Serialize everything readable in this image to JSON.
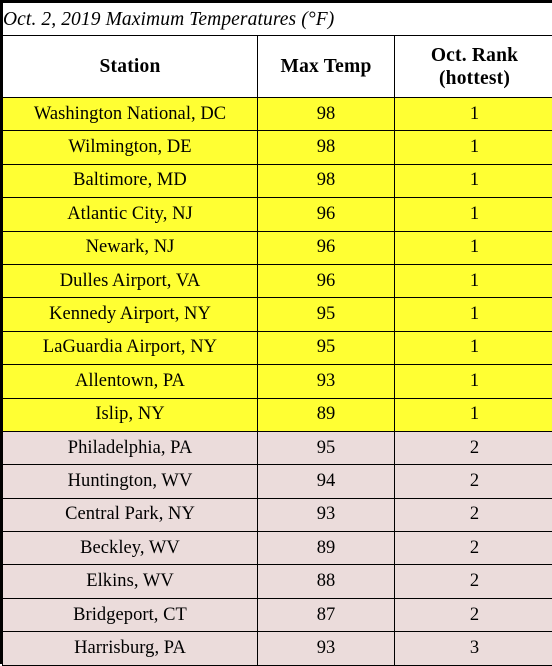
{
  "table": {
    "title": "Oct. 2, 2019 Maximum Temperatures (°F)",
    "columns": [
      {
        "key": "station",
        "label": "Station"
      },
      {
        "key": "max_temp",
        "label": "Max Temp"
      },
      {
        "key": "rank_line1",
        "label": "Oct. Rank"
      },
      {
        "key": "rank_line2",
        "label": "(hottest)"
      }
    ],
    "header": {
      "station": "Station",
      "max_temp": "Max Temp",
      "rank_line1": "Oct. Rank",
      "rank_line2": "(hottest)"
    },
    "colors": {
      "band_rank1": "#FFFF33",
      "band_rank2": "#EBDCDB",
      "border": "#000000",
      "text": "#000000",
      "background": "#FFFFFF"
    },
    "rows": [
      {
        "station": "Washington National, DC",
        "max_temp": "98",
        "rank": "1",
        "band": "yellow"
      },
      {
        "station": "Wilmington, DE",
        "max_temp": "98",
        "rank": "1",
        "band": "yellow"
      },
      {
        "station": "Baltimore, MD",
        "max_temp": "98",
        "rank": "1",
        "band": "yellow"
      },
      {
        "station": "Atlantic City, NJ",
        "max_temp": "96",
        "rank": "1",
        "band": "yellow"
      },
      {
        "station": "Newark, NJ",
        "max_temp": "96",
        "rank": "1",
        "band": "yellow"
      },
      {
        "station": "Dulles Airport, VA",
        "max_temp": "96",
        "rank": "1",
        "band": "yellow"
      },
      {
        "station": "Kennedy Airport, NY",
        "max_temp": "95",
        "rank": "1",
        "band": "yellow"
      },
      {
        "station": "LaGuardia Airport, NY",
        "max_temp": "95",
        "rank": "1",
        "band": "yellow"
      },
      {
        "station": "Allentown, PA",
        "max_temp": "93",
        "rank": "1",
        "band": "yellow"
      },
      {
        "station": "Islip, NY",
        "max_temp": "89",
        "rank": "1",
        "band": "yellow"
      },
      {
        "station": "Philadelphia, PA",
        "max_temp": "95",
        "rank": "2",
        "band": "pink"
      },
      {
        "station": "Huntington, WV",
        "max_temp": "94",
        "rank": "2",
        "band": "pink"
      },
      {
        "station": "Central Park, NY",
        "max_temp": "93",
        "rank": "2",
        "band": "pink"
      },
      {
        "station": "Beckley, WV",
        "max_temp": "89",
        "rank": "2",
        "band": "pink"
      },
      {
        "station": "Elkins, WV",
        "max_temp": "88",
        "rank": "2",
        "band": "pink"
      },
      {
        "station": "Bridgeport, CT",
        "max_temp": "87",
        "rank": "2",
        "band": "pink"
      },
      {
        "station": "Harrisburg, PA",
        "max_temp": "93",
        "rank": "3",
        "band": "pink"
      }
    ]
  },
  "chart_data": {
    "type": "table",
    "title": "Oct. 2, 2019 Maximum Temperatures (°F)",
    "columns": [
      "Station",
      "Max Temp",
      "Oct. Rank (hottest)"
    ],
    "rows": [
      [
        "Washington National, DC",
        98,
        1
      ],
      [
        "Wilmington, DE",
        98,
        1
      ],
      [
        "Baltimore, MD",
        98,
        1
      ],
      [
        "Atlantic City, NJ",
        96,
        1
      ],
      [
        "Newark, NJ",
        96,
        1
      ],
      [
        "Dulles Airport, VA",
        96,
        1
      ],
      [
        "Kennedy Airport, NY",
        95,
        1
      ],
      [
        "LaGuardia Airport, NY",
        95,
        1
      ],
      [
        "Allentown, PA",
        93,
        1
      ],
      [
        "Islip, NY",
        89,
        1
      ],
      [
        "Philadelphia, PA",
        95,
        2
      ],
      [
        "Huntington, WV",
        94,
        2
      ],
      [
        "Central Park, NY",
        93,
        2
      ],
      [
        "Beckley, WV",
        89,
        2
      ],
      [
        "Elkins, WV",
        88,
        2
      ],
      [
        "Bridgeport, CT",
        87,
        2
      ],
      [
        "Harrisburg, PA",
        93,
        3
      ]
    ]
  }
}
